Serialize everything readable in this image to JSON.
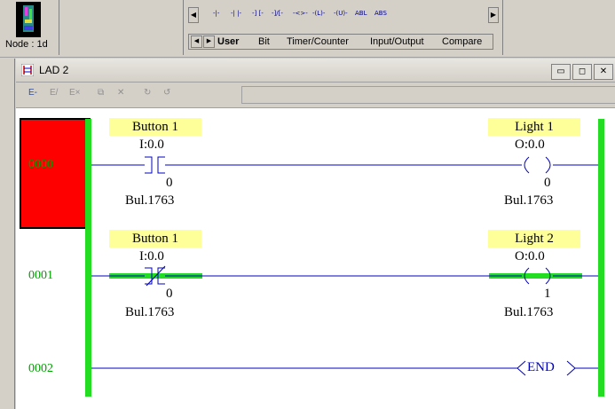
{
  "node": {
    "label": "Node :  1d",
    "icon": "processor-icon"
  },
  "instruction_toolbar": {
    "items": [
      "-|-",
      "-| |-",
      "-] [-",
      "-]/[-",
      "-<>-",
      "-(L)-",
      "-(U)-",
      "ABL",
      "ABS"
    ],
    "tabs": [
      "User",
      "Bit",
      "Timer/Counter",
      "Input/Output",
      "Compare"
    ],
    "active_tab": "User"
  },
  "window": {
    "title": "LAD 2",
    "buttons": {
      "minimize": "▭",
      "restore": "◻",
      "close": "✕"
    }
  },
  "ladder_tools": [
    "E-",
    "E/",
    "E×",
    "⧉",
    "✕",
    "↻",
    "↺"
  ],
  "rungs": [
    {
      "number": "0000",
      "instruction": {
        "tag": "Button 1",
        "address": "I:0.0",
        "value": "0",
        "device": "Bul.1763"
      },
      "output": {
        "tag": "Light 1",
        "address": "O:0.0",
        "value": "0",
        "device": "Bul.1763"
      }
    },
    {
      "number": "0001",
      "instruction": {
        "tag": "Button 1",
        "address": "I:0.0",
        "value": "0",
        "device": "Bul.1763"
      },
      "output": {
        "tag": "Light 2",
        "address": "O:0.0",
        "value": "1",
        "device": "Bul.1763"
      }
    },
    {
      "number": "0002",
      "end_label": "END"
    }
  ],
  "colors": {
    "power_rail": "#22dd22",
    "selected_rung": "#ff0000",
    "wire": "#0000c0",
    "tag_bg": "#ffff99"
  }
}
